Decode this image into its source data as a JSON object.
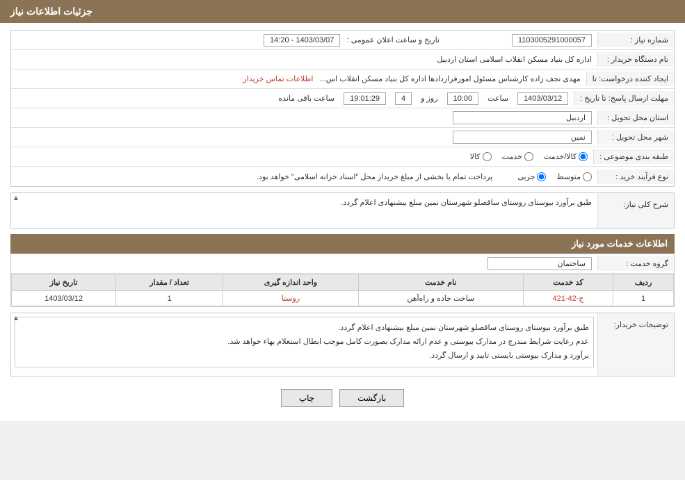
{
  "page": {
    "title": "جزئیات اطلاعات نیاز"
  },
  "header": {
    "title": "جزئیات اطلاعات نیاز"
  },
  "form": {
    "fields": {
      "need_number_label": "شماره نیاز :",
      "need_number_value": "1103005291000057",
      "buyer_org_label": "نام دستگاه خریدار :",
      "buyer_org_value": "اداره کل بنیاد مسکن انقلاب اسلامی استان اردبیل",
      "creator_label": "ایجاد کننده درخواست: تا",
      "creator_value": "مهدی نجف زاده کارشناس مسئول امورفراردادها اداره کل بنیاد مسکن انقلاب اس...",
      "creator_link": "اطلاعات تماس خریدار",
      "datetime_label": "تاریخ و ساعت اعلان عمومی :",
      "datetime_value": "1403/03/07 - 14:20",
      "deadline_label": "مهلت ارسال پاسخ: تا تاریخ :",
      "deadline_date": "1403/03/12",
      "deadline_time": "10:00",
      "deadline_days": "4",
      "deadline_remaining": "19:01:29",
      "deadline_suffix": "ساعت باقی مانده",
      "province_label": "استان محل تحویل :",
      "province_value": "اردبیل",
      "city_label": "شهر محل تحویل :",
      "city_value": "نمین",
      "category_label": "طبقه بندی موضوعی :",
      "category_options": [
        "کالا",
        "خدمت",
        "کالا/خدمت"
      ],
      "category_selected": "کالا/خدمت",
      "purchase_type_label": "نوع فرآیند خرید :",
      "purchase_type_options": [
        "جزیی",
        "متوسط"
      ],
      "purchase_type_note": "پرداخت تمام یا بخشی از مبلغ خریداز محل \"اسناد خزانه اسلامی\" خواهد بود.",
      "need_description_label": "شرح کلی نیاز:",
      "need_description_value": "طبق برآورد بیوستای روستای ساقصلو شهرستان نمین مبلغ بیشنهادی اعلام گردد."
    },
    "services_section": {
      "title": "اطلاعات خدمات مورد نیاز",
      "service_group_label": "گروه خدمت :",
      "service_group_value": "ساختمان",
      "table": {
        "columns": [
          "ردیف",
          "کد خدمت",
          "نام خدمت",
          "واحد اندازه گیری",
          "تعداد / مقدار",
          "تاریخ نیاز"
        ],
        "rows": [
          {
            "row_num": "1",
            "service_code": "ج-42-421",
            "service_name": "ساخت جاده و راه‌آهن",
            "unit": "روستا",
            "quantity": "1",
            "date": "1403/03/12"
          }
        ]
      }
    },
    "buyer_notes_label": "توضیحات خریدار:",
    "buyer_notes_value": "طبق برآورد بیوستای روستای ساقصلو شهرستان نمین مبلغ بیشنهادی اعلام گردد.\nعدم رعایت شرایط مندرج در مدارک بیوستی و عدم ارائه مدارک بصورت کامل موجب ابطال استعلام بهاء خواهد شد.\nبرآورد و مدارک بیوستی بایستی تایید و ارسال گردد.",
    "buttons": {
      "back_label": "بازگشت",
      "print_label": "چاپ"
    }
  }
}
